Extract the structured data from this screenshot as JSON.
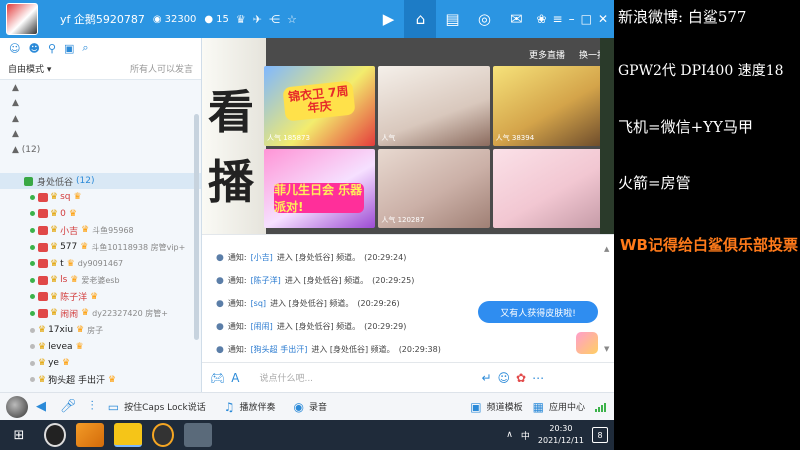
{
  "titlebar": {
    "user_name": "yf 企鹅5920787",
    "stat_coins": "32300",
    "stat_members": "15",
    "icons": [
      "crown-icon",
      "people-icon",
      "user-icon",
      "plane-icon",
      "share-icon",
      "star-icon"
    ],
    "nav_icons": [
      "video-icon",
      "home-icon",
      "list-icon",
      "game-icon",
      "mail-icon"
    ],
    "window_icons": [
      "skin-icon",
      "menu-icon",
      "minimize-icon",
      "maximize-icon",
      "close-icon"
    ]
  },
  "left": {
    "mode_label": "自由模式",
    "mode_hint": "所有人可以发言",
    "count_label": "(12)",
    "group_name": "身处低谷",
    "group_count": "(12)",
    "users": [
      {
        "name": "sq",
        "style": "red",
        "badge": "#e04848",
        "lv": "",
        "extra": ""
      },
      {
        "name": "0",
        "style": "red",
        "badge": "#e04848",
        "lv": "",
        "extra": ""
      },
      {
        "name": "小吉",
        "style": "red",
        "badge": "#e04848",
        "lv": "",
        "extra": "斗鱼95968"
      },
      {
        "name": "577",
        "style": "dark",
        "badge": "#e04848",
        "lv": "",
        "extra": "斗鱼10118938 房管vip+"
      },
      {
        "name": "t",
        "style": "dark",
        "badge": "#e04848",
        "lv": "",
        "extra": "dy9091467"
      },
      {
        "name": "ls",
        "style": "red",
        "badge": "#e04848",
        "lv": "",
        "extra": "爱老婆esb"
      },
      {
        "name": "陈子洋",
        "style": "red",
        "badge": "#e04848",
        "lv": "",
        "extra": ""
      },
      {
        "name": "闹闹",
        "style": "red",
        "badge": "#e04848",
        "lv": "",
        "extra": "dy22327420 房管+"
      },
      {
        "name": "17xiu",
        "style": "dark",
        "badge": "",
        "lv": "",
        "extra": "房子"
      },
      {
        "name": "levea",
        "style": "dark",
        "badge": "",
        "lv": "",
        "extra": ""
      },
      {
        "name": "ye",
        "style": "dark",
        "badge": "",
        "lv": "",
        "extra": ""
      },
      {
        "name": "狗头超 手出汗",
        "style": "dark",
        "badge": "",
        "lv": "",
        "extra": ""
      }
    ]
  },
  "stream": {
    "more_label": "更多直播",
    "switch_label": "换一批",
    "calligraphy": [
      "看",
      "播"
    ],
    "pop_label": "人气",
    "cards": [
      {
        "pop": "185873",
        "banner": "锦衣卫 7周年庆"
      },
      {
        "pop": "",
        "banner": ""
      },
      {
        "pop": "38394",
        "banner": ""
      },
      {
        "pop": "",
        "banner": "菲儿生日会 乐器派对!"
      },
      {
        "pop": "120287",
        "banner": ""
      },
      {
        "pop": "",
        "banner": ""
      }
    ]
  },
  "chat": {
    "messages": [
      {
        "prefix": "通知:",
        "name": "[小吉]",
        "text": "进入 [身处低谷] 频道。",
        "time": "(20:29:24)"
      },
      {
        "prefix": "通知:",
        "name": "[陈子洋]",
        "text": "进入 [身处低谷] 频道。",
        "time": "(20:29:25)"
      },
      {
        "prefix": "通知:",
        "name": "[sq]",
        "text": "进入 [身处低谷] 频道。",
        "time": "(20:29:26)"
      },
      {
        "prefix": "通知:",
        "name": "[闹闹]",
        "text": "进入 [身处低谷] 频道。",
        "time": "(20:29:29)"
      },
      {
        "prefix": "通知:",
        "name": "[狗头超 手出汗]",
        "text": "进入 [身处低谷] 频道。",
        "time": "(20:29:38)"
      }
    ],
    "bubble": "又有人获得皮肤啦!",
    "input_placeholder": "说点什么吧..."
  },
  "toolbar": {
    "caps_label": "按住Caps Lock说话",
    "music_label": "播放伴奏",
    "record_label": "录音",
    "channel_template": "频道模板",
    "app_center": "应用中心"
  },
  "taskbar": {
    "time": "20:30",
    "date": "2021/12/11",
    "ime": "中",
    "notify_count": "8"
  },
  "overlay": {
    "lines": [
      "新浪微博: 白鲨577",
      "GPW2代 DPI400 速度18",
      "飞机=微信+YY马甲",
      "火箭=房管"
    ],
    "accent": "WB记得给白鲨俱乐部投票",
    "accent_color": "#ff7a1a"
  }
}
